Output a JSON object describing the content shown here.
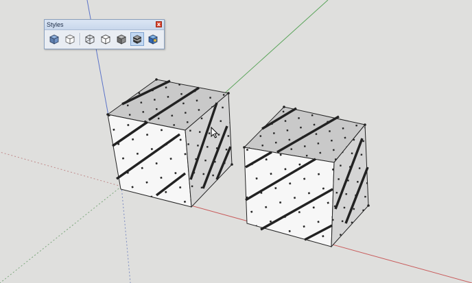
{
  "window": {
    "title": "Styles",
    "close_label": "x"
  },
  "toolbar_buttons": [
    {
      "name": "xray-style-button",
      "icon": "xray-icon",
      "active": false
    },
    {
      "name": "back-edges-style-button",
      "icon": "back-edges-icon",
      "active": false
    },
    {
      "name": "wireframe-style-button",
      "icon": "wireframe-icon",
      "active": false
    },
    {
      "name": "hidden-line-style-button",
      "icon": "hidden-line-icon",
      "active": false
    },
    {
      "name": "shaded-style-button",
      "icon": "shaded-icon",
      "active": false
    },
    {
      "name": "shaded-with-textures-style-button",
      "icon": "shaded-textures-icon",
      "active": true
    },
    {
      "name": "monochrome-style-button",
      "icon": "monochrome-icon",
      "active": false
    }
  ],
  "colors": {
    "background": "#dfdfdd",
    "axis_red": "#c85a5a",
    "axis_green": "#5aa45a",
    "axis_blue": "#5a72c8",
    "active_button": "#c2d8f2"
  }
}
